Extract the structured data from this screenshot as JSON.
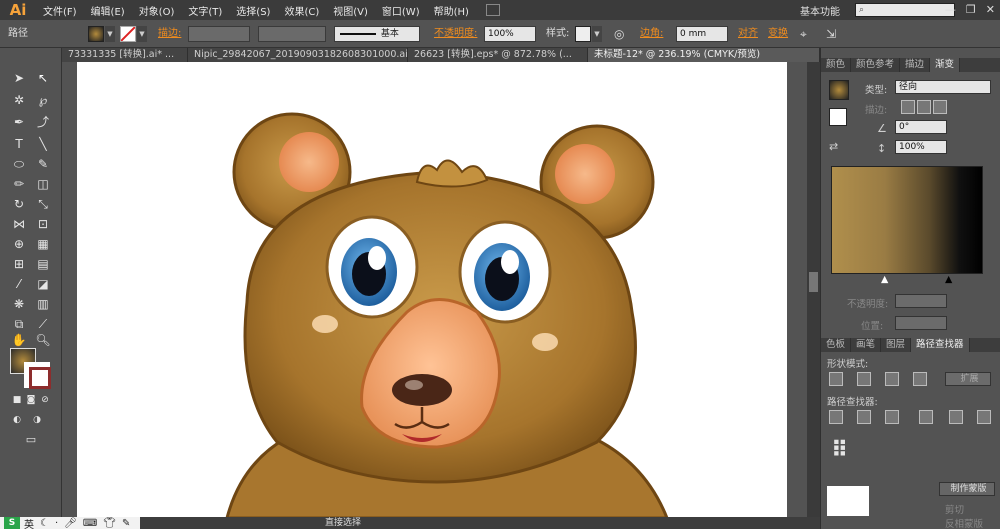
{
  "app": {
    "logo": "Ai"
  },
  "menu": {
    "items": [
      "文件(F)",
      "编辑(E)",
      "对象(O)",
      "文字(T)",
      "选择(S)",
      "效果(C)",
      "视图(V)",
      "窗口(W)",
      "帮助(H)"
    ]
  },
  "workspace": {
    "label": "基本功能",
    "search_icon": "search-icon"
  },
  "window_controls": {
    "minimize": "—",
    "restore": "❐",
    "close": "✕"
  },
  "control_bar": {
    "selection_label": "路径",
    "stroke_label": "描边:",
    "brush_label": "基本",
    "opacity_label": "不透明度:",
    "opacity_value": "100%",
    "style_label": "样式:",
    "corner_label": "边角:",
    "corner_value": "0 mm",
    "align_label": "对齐",
    "transform_label": "变换"
  },
  "tabs": [
    {
      "label": "73331335 [转换].ai* ...",
      "active": false
    },
    {
      "label": "Nipic_29842067_20190903182608301000.ai*",
      "active": false
    },
    {
      "label": "26623 [转换].eps* @ 872.78% (...",
      "active": false
    },
    {
      "label": "未标题-12* @ 236.19% (CMYK/预览)",
      "active": true
    }
  ],
  "panels": {
    "top_tabs": [
      "颜色",
      "颜色参考",
      "描边",
      "渐变"
    ],
    "gradient": {
      "type_label": "类型:",
      "type_value": "径向",
      "stroke_label": "描边:",
      "angle_value": "0°",
      "ratio_value": "100%",
      "opacity_label": "不透明度:",
      "position_label": "位置:"
    },
    "bottom_tabs": [
      "色板",
      "画笔",
      "图层",
      "路径查找器"
    ],
    "pathfinder": {
      "shape_modes_label": "形状模式:",
      "expand_label": "扩展",
      "pathfinders_label": "路径查找器:"
    },
    "transparency": {
      "make_mask_label": "制作蒙版",
      "clip_label": "剪切",
      "invert_label": "反相蒙版"
    }
  },
  "status": {
    "tool_label": "直接选择",
    "ime_lang": "英"
  }
}
